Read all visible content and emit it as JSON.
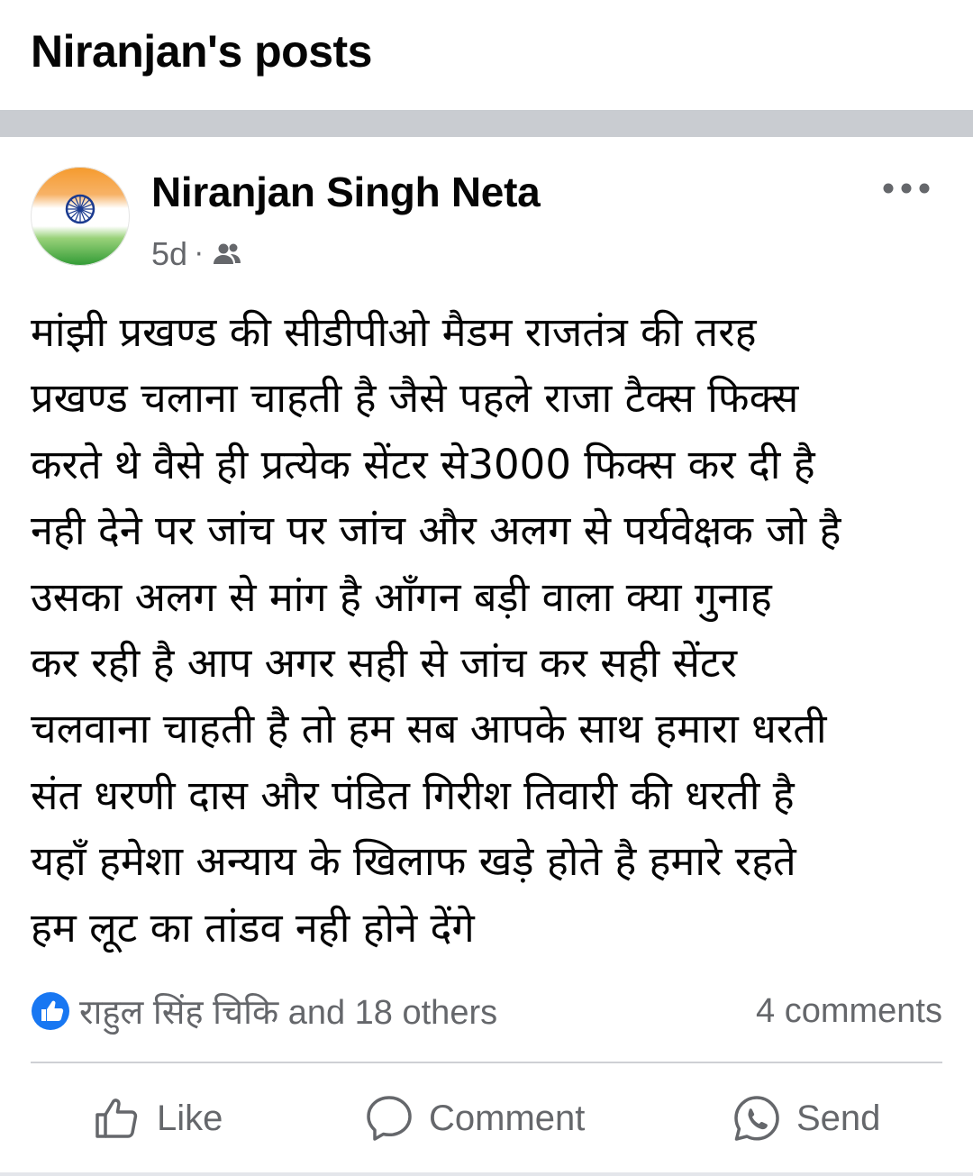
{
  "header": {
    "title": "Niranjan's posts"
  },
  "post": {
    "author": "Niranjan Singh Neta",
    "time": "5d",
    "separator": "·",
    "audience_icon": "friends-icon",
    "more_icon": "more-horizontal-icon",
    "body": "मांझी प्रखण्ड की सीडीपीओ मैडम राजतंत्र की तरह\nप्रखण्ड चलाना चाहती है जैसे पहले राजा टैक्स फिक्स\nकरते थे वैसे ही प्रत्येक सेंटर से3000 फिक्स कर दी है\nनही देने पर जांच पर जांच और अलग से  पर्यवेक्षक जो है\nउसका अलग से   मांग है आँगन  बड़ी वाला क्या गुनाह\nकर रही है  आप अगर सही से जांच कर सही सेंटर\nचलवाना चाहती है तो हम सब आपके साथ  हमारा धरती\nसंत धरणी दास और पंडित गिरीश तिवारी की धरती है\nयहाँ हमेशा अन्याय के खिलाफ खड़े होते है हमारे रहते\nहम लूट का तांडव नही होने देंगे",
    "reactions_text": "राहुल सिंह चिकि and 18 others",
    "reaction_icon": "like-reaction-icon",
    "comments_text": "4 comments"
  },
  "actions": {
    "like_label": "Like",
    "comment_label": "Comment",
    "send_label": "Send"
  },
  "colors": {
    "text": "#050505",
    "secondary_text": "#65676b",
    "like_blue": "#1877f2",
    "separator_band": "#c9ccd1"
  }
}
